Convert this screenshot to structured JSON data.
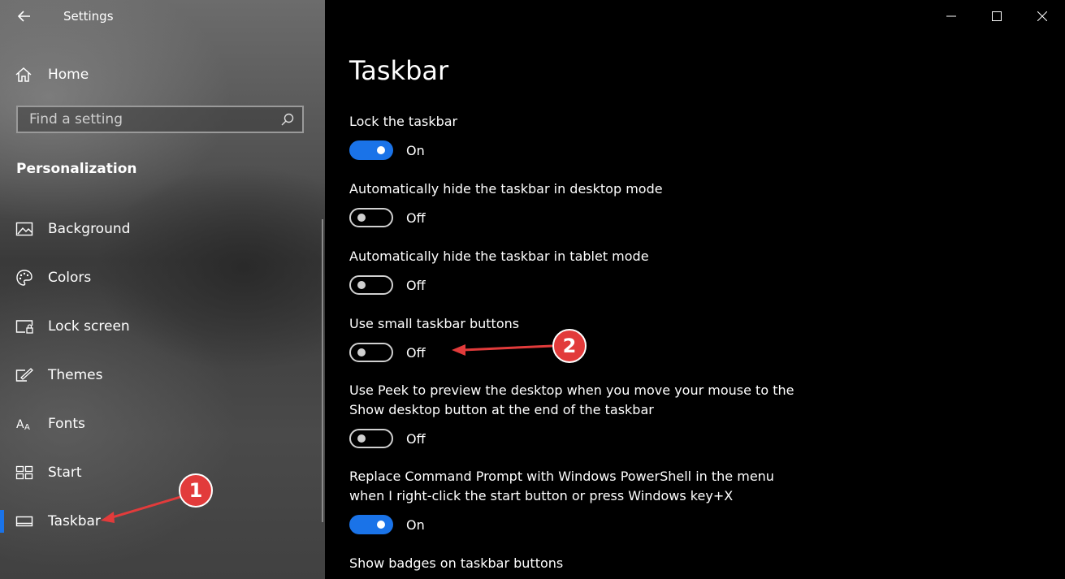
{
  "window": {
    "title": "Settings",
    "controls": [
      "minimize-icon",
      "maximize-icon",
      "close-icon"
    ]
  },
  "sidebar": {
    "home_label": "Home",
    "search": {
      "placeholder": "Find a setting",
      "value": ""
    },
    "section_heading": "Personalization",
    "items": [
      {
        "label": "Background",
        "icon": "background-icon",
        "selected": false
      },
      {
        "label": "Colors",
        "icon": "palette-icon",
        "selected": false
      },
      {
        "label": "Lock screen",
        "icon": "lock-screen-icon",
        "selected": false
      },
      {
        "label": "Themes",
        "icon": "themes-icon",
        "selected": false
      },
      {
        "label": "Fonts",
        "icon": "fonts-icon",
        "selected": false
      },
      {
        "label": "Start",
        "icon": "start-icon",
        "selected": false
      },
      {
        "label": "Taskbar",
        "icon": "taskbar-icon",
        "selected": true
      }
    ]
  },
  "main": {
    "title": "Taskbar",
    "settings": [
      {
        "label": "Lock the taskbar",
        "state": "On",
        "on": true
      },
      {
        "label": "Automatically hide the taskbar in desktop mode",
        "state": "Off",
        "on": false
      },
      {
        "label": "Automatically hide the taskbar in tablet mode",
        "state": "Off",
        "on": false
      },
      {
        "label": "Use small taskbar buttons",
        "state": "Off",
        "on": false
      },
      {
        "label": "Use Peek to preview the desktop when you move your mouse to the Show desktop button at the end of the taskbar",
        "state": "Off",
        "on": false
      },
      {
        "label": "Replace Command Prompt with Windows PowerShell in the menu when I right-click the start button or press Windows key+X",
        "state": "On",
        "on": true
      },
      {
        "label": "Show badges on taskbar buttons"
      }
    ]
  },
  "annotations": {
    "badge1": "1",
    "badge2": "2",
    "color": "#e23b3b"
  },
  "colors": {
    "accent": "#1a73e8",
    "background": "#000000"
  }
}
